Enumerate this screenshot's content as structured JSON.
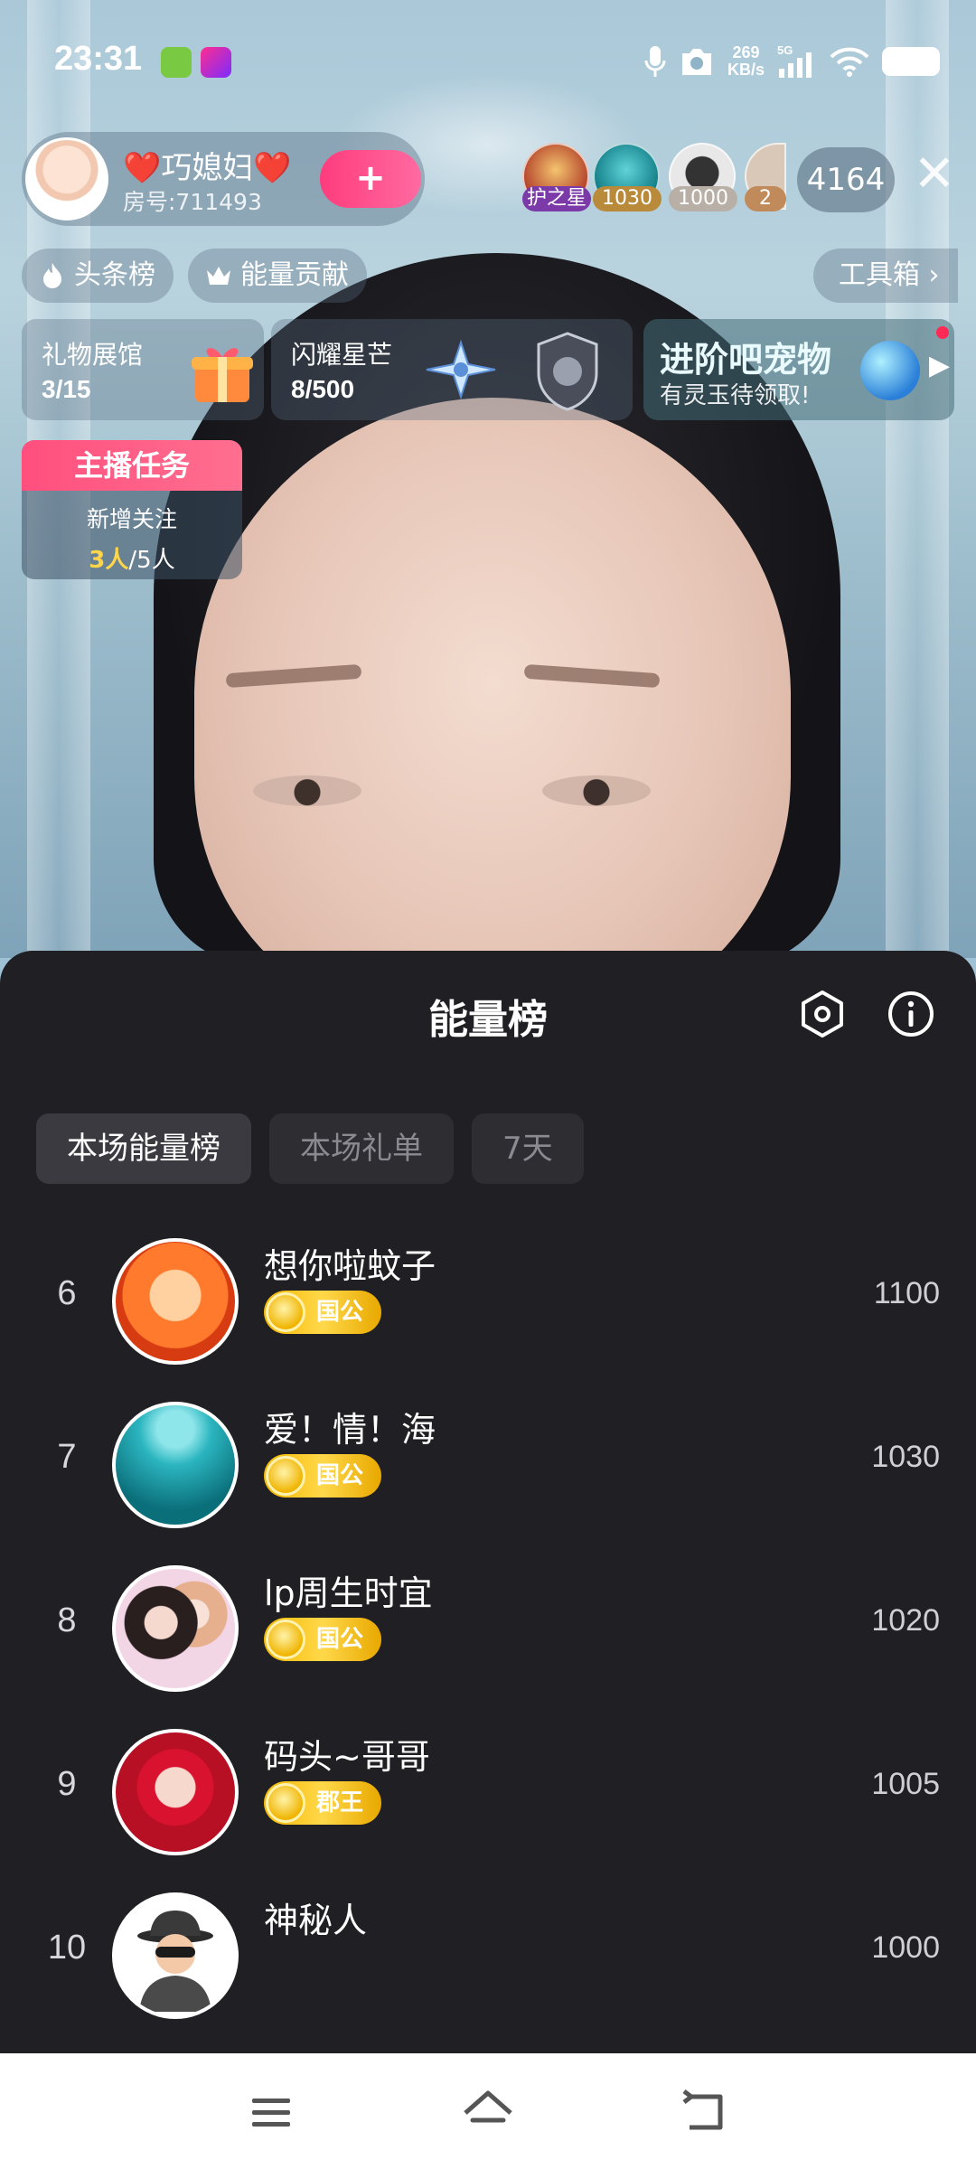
{
  "status_bar": {
    "time": "23:31",
    "speed_value": "269",
    "speed_unit": "KB/s",
    "network": "5G"
  },
  "host": {
    "name": "❤️巧媳妇❤️",
    "room": "房号:711493",
    "follow_label": "+"
  },
  "viewers": [
    {
      "tag": "护之星",
      "color": "#7b3aa8"
    },
    {
      "tag": "1030",
      "color": "#b98a3a"
    },
    {
      "tag": "1000",
      "color": "#b8b0a6"
    },
    {
      "tag": "2",
      "color": "#c08a5a"
    }
  ],
  "viewer_count": "4164",
  "top_pills": {
    "headline": "头条榜",
    "energy": "能量贡献",
    "toolbox": "工具箱 ›"
  },
  "feature_cards": [
    {
      "title": "礼物展馆",
      "value": "3/15"
    },
    {
      "title": "闪耀星芒",
      "value": "8/500"
    }
  ],
  "promo": {
    "title": "进阶吧宠物",
    "subtitle": "有灵玉待领取!"
  },
  "task": {
    "header": "主播任务",
    "label": "新增关注",
    "done": "3人",
    "total": "/5人"
  },
  "sheet": {
    "title": "能量榜",
    "tabs": [
      "本场能量榜",
      "本场礼单",
      "7天"
    ],
    "entries": [
      {
        "rank": "6",
        "name": "想你啦蚊子",
        "badge": "国公",
        "score": "1100"
      },
      {
        "rank": "7",
        "name": "爱！情！海",
        "badge": "国公",
        "score": "1030"
      },
      {
        "rank": "8",
        "name": "lp周生时宜",
        "badge": "国公",
        "score": "1020"
      },
      {
        "rank": "9",
        "name": "码头~哥哥",
        "badge": "郡王",
        "score": "1005"
      },
      {
        "rank": "10",
        "name": "神秘人",
        "badge": "",
        "score": "1000"
      }
    ]
  },
  "colors": {
    "sheet_bg": "#202024",
    "badge_gold": "#f6b800",
    "accent_pink": "#ff4f7e"
  }
}
